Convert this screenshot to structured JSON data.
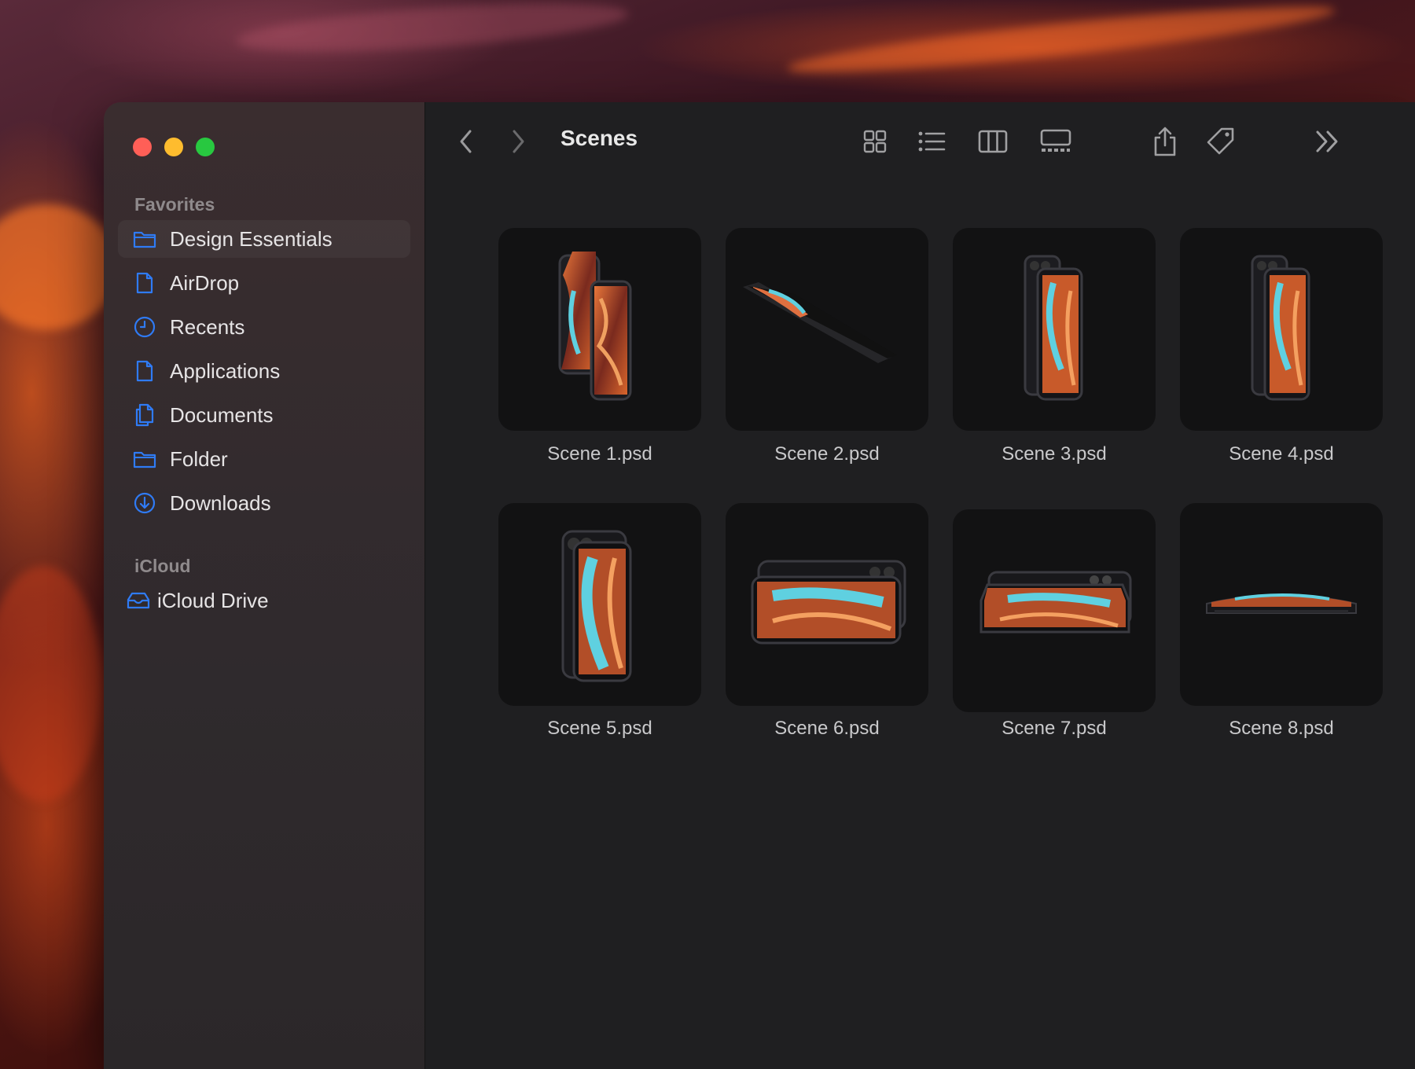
{
  "window": {
    "title": "Scenes"
  },
  "sidebar": {
    "favorites_label": "Favorites",
    "favorites": [
      {
        "label": "Design Essentials",
        "icon": "folder-icon"
      },
      {
        "label": "AirDrop",
        "icon": "document-icon"
      },
      {
        "label": "Recents",
        "icon": "clock-icon"
      },
      {
        "label": "Applications",
        "icon": "document-icon"
      },
      {
        "label": "Documents",
        "icon": "documents-icon"
      },
      {
        "label": "Folder",
        "icon": "folder-icon"
      },
      {
        "label": "Downloads",
        "icon": "download-icon"
      }
    ],
    "icloud_label": "iCloud",
    "icloud": [
      {
        "label": "iCloud Drive",
        "icon": "drive-icon"
      }
    ]
  },
  "files": [
    {
      "name": "Scene 1.psd"
    },
    {
      "name": "Scene 2.psd"
    },
    {
      "name": "Scene 3.psd"
    },
    {
      "name": "Scene 4.psd"
    },
    {
      "name": "Scene 5.psd"
    },
    {
      "name": "Scene 6.psd"
    },
    {
      "name": "Scene 7.psd"
    },
    {
      "name": "Scene 8.psd"
    }
  ],
  "colors": {
    "accent": "#2f7bf5",
    "sidebar_text": "#e6e4e5",
    "window_bg": "#1f1f21"
  }
}
